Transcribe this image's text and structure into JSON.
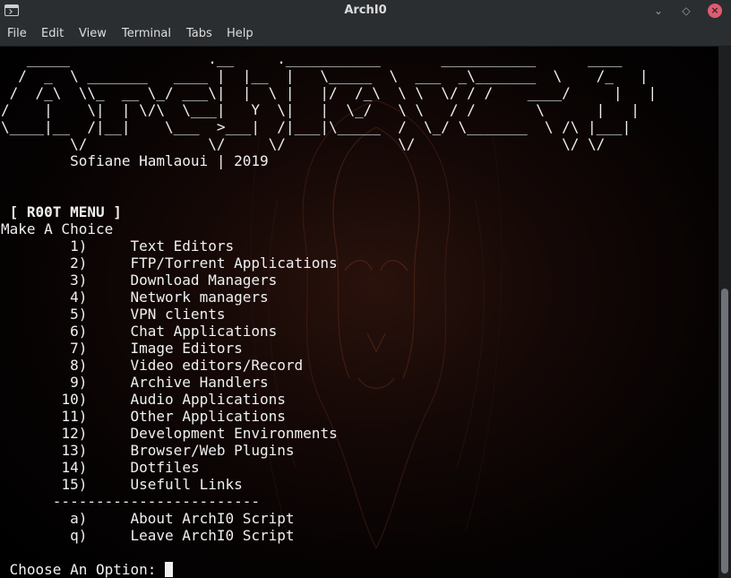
{
  "window": {
    "title": "ArchI0",
    "minimize_glyph": "⌄",
    "maximize_glyph": "◇",
    "close_glyph": "×"
  },
  "menubar": {
    "file": "File",
    "edit": "Edit",
    "view": "View",
    "terminal": "Terminal",
    "tabs": "Tabs",
    "help": "Help"
  },
  "banner": {
    "art_lines": [
      "   _____                .__     .___________       ___________      ____",
      "  /  _  \\ _______   ____ |  |__  |   \\_____  \\  ___  _\\_______  \\    /_   |",
      " /  /_\\  \\\\_  __ \\_/ ___\\|  |  \\ |   |/  /_\\  \\ \\  \\/ / /    ____/     |   |",
      "/    |    \\|  | \\/\\  \\___|   Y  \\|   |  \\_/   \\ \\   / /       \\      |   |",
      "\\____|__  /|__|    \\___  >___|  /|___|\\_____  /  \\_/ \\_______  \\ /\\ |___|",
      "        \\/              \\/     \\/             \\/                 \\/ \\/"
    ],
    "author": "        Sofiane Hamlaoui | 2019"
  },
  "menu": {
    "header": " [ R00T MENU ]",
    "prompt": "Make A Choice",
    "items": [
      {
        "key": "1)",
        "label": "Text Editors"
      },
      {
        "key": "2)",
        "label": "FTP/Torrent Applications"
      },
      {
        "key": "3)",
        "label": "Download Managers"
      },
      {
        "key": "4)",
        "label": "Network managers"
      },
      {
        "key": "5)",
        "label": "VPN clients"
      },
      {
        "key": "6)",
        "label": "Chat Applications"
      },
      {
        "key": "7)",
        "label": "Image Editors"
      },
      {
        "key": "8)",
        "label": "Video editors/Record"
      },
      {
        "key": "9)",
        "label": "Archive Handlers"
      },
      {
        "key": "10)",
        "label": "Audio Applications"
      },
      {
        "key": "11)",
        "label": "Other Applications"
      },
      {
        "key": "12)",
        "label": "Development Environments"
      },
      {
        "key": "13)",
        "label": "Browser/Web Plugins"
      },
      {
        "key": "14)",
        "label": "Dotfiles"
      },
      {
        "key": "15)",
        "label": "Usefull Links"
      }
    ],
    "separator": "      ------------------------",
    "extra_items": [
      {
        "key": "a)",
        "label": "About ArchI0 Script"
      },
      {
        "key": "q)",
        "label": "Leave ArchI0 Script"
      }
    ],
    "input_prompt": " Choose An Option: "
  },
  "colors": {
    "chrome": "#2b2e31",
    "text": "#f0f0f0",
    "close_button": "#e05c6e",
    "scroll_thumb": "#6f7377"
  }
}
